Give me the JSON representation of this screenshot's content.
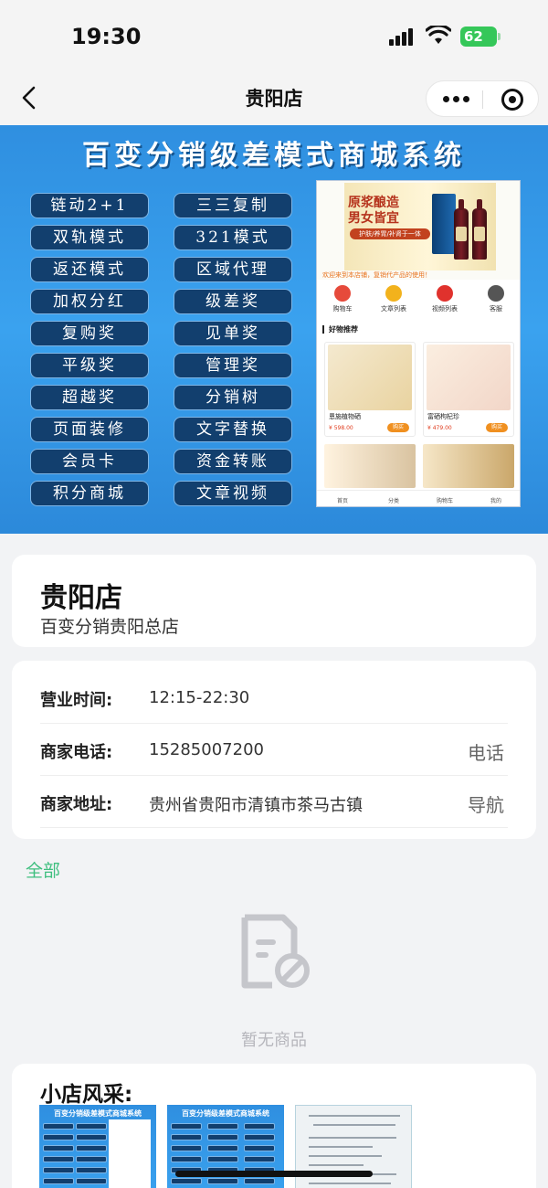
{
  "status_bar": {
    "time": "19:30",
    "battery": "62"
  },
  "nav": {
    "title": "贵阳店"
  },
  "banner": {
    "title": "百变分销级差模式商城系统",
    "features": [
      "链动2+1",
      "三三复制",
      "双轨模式",
      "321模式",
      "返还模式",
      "区域代理",
      "加权分红",
      "级差奖",
      "复购奖",
      "见单奖",
      "平级奖",
      "管理奖",
      "超越奖",
      "分销树",
      "页面装修",
      "文字替换",
      "会员卡",
      "资金转账",
      "积分商城",
      "文章视频"
    ],
    "mock": {
      "hero_line1": "原浆酿造",
      "hero_line2": "男女皆宜",
      "hero_sub": "护肤/养胃/补肾于一体",
      "notice": "欢迎来到本店铺，复销代产品的使用！",
      "categories": [
        "购物车",
        "文章列表",
        "视频列表",
        "客服"
      ],
      "section_title": "好物推荐",
      "products": [
        {
          "name": "恩施植物硒",
          "price": "¥ 598.00",
          "buy": "购买"
        },
        {
          "name": "富硒枸杞珍",
          "price": "¥ 479.00",
          "buy": "购买"
        }
      ],
      "tabs": [
        "首页",
        "分类",
        "购物车",
        "我的"
      ]
    }
  },
  "store": {
    "name": "贵阳店",
    "subtitle": "百变分销贵阳总店"
  },
  "info": {
    "hours_label": "营业时间:",
    "hours_value": "12:15-22:30",
    "phone_label": "商家电话:",
    "phone_value": "15285007200",
    "phone_action": "电话",
    "address_label": "商家地址:",
    "address_value": "贵州省贵阳市清镇市茶马古镇",
    "address_action": "导航"
  },
  "category_tab": "全部",
  "empty_text": "暂无商品",
  "gallery": {
    "title": "小店风采:",
    "thumb_banner_title": "百变分销级差模式商城系统"
  },
  "colors": {
    "accent_green": "#3fbf7f",
    "banner_blue": "#3aa2ef",
    "battery_green": "#35c759"
  }
}
